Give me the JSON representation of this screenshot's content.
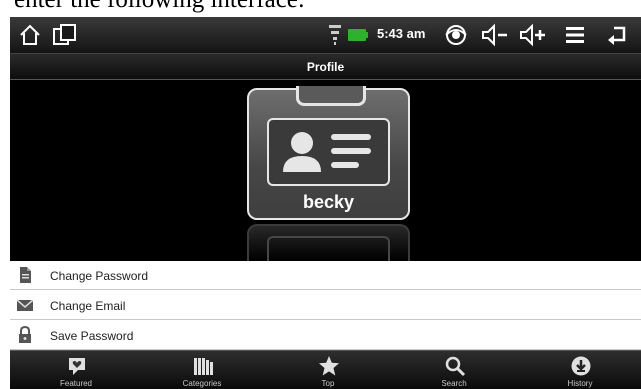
{
  "caption": {
    "text": "enter the following interface:"
  },
  "status_bar": {
    "time": "5:43 am",
    "icons": [
      "home-icon",
      "windows-icon",
      "wifi-icon",
      "battery-icon",
      "eye-icon",
      "volume-down-icon",
      "volume-up-icon",
      "menu-icon",
      "back-icon"
    ]
  },
  "title_bar": {
    "title": "Profile"
  },
  "profile": {
    "user_name": "becky"
  },
  "menu": {
    "items": [
      {
        "label": "Change Password",
        "icon": "document-icon"
      },
      {
        "label": "Change Email",
        "icon": "envelope-icon"
      },
      {
        "label": "Save Password",
        "icon": "lock-icon"
      }
    ]
  },
  "bottom_nav": {
    "items": [
      {
        "label": "Featured",
        "icon": "heart-chat-icon"
      },
      {
        "label": "Categories",
        "icon": "books-icon"
      },
      {
        "label": "Top",
        "icon": "star-icon"
      },
      {
        "label": "Search",
        "icon": "search-icon"
      },
      {
        "label": "History",
        "icon": "download-icon"
      }
    ]
  },
  "colors": {
    "accent_battery": "#2fb12f",
    "bar_dark": "#141414",
    "label_gray": "#c8c8c8"
  }
}
